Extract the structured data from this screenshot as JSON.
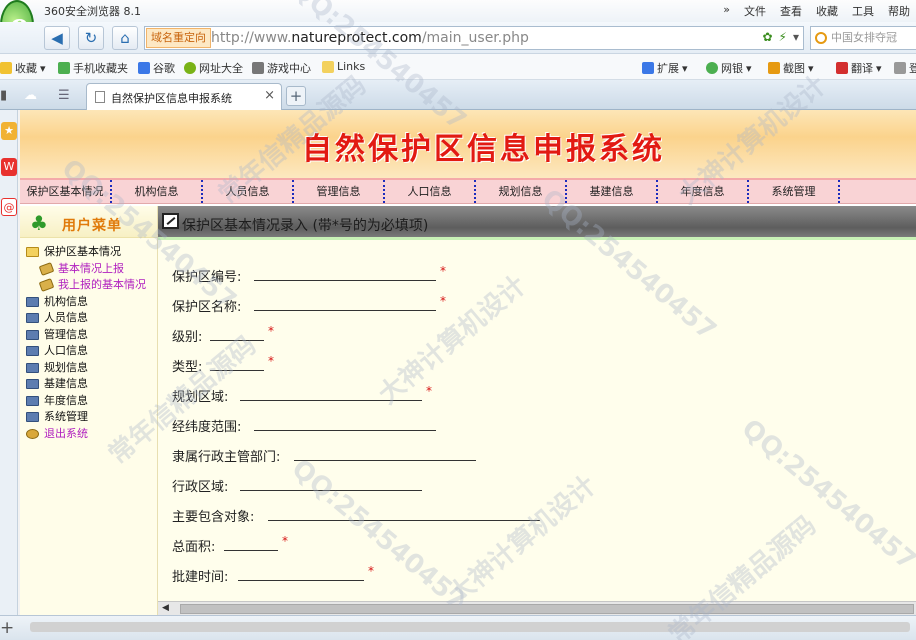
{
  "browser": {
    "title": "360安全浏览器 8.1",
    "menu": [
      "文件",
      "查看",
      "收藏",
      "工具",
      "帮助"
    ]
  },
  "address": {
    "redirect_label": "域名重定向",
    "url_prefix": "http://www.",
    "url_domain": "natureprotect.com",
    "url_path": "/main_user.php",
    "search_placeholder": "中国女排夺冠"
  },
  "bookmarks": {
    "left": [
      "收藏",
      "手机收藏夹",
      "谷歌",
      "网址大全",
      "游戏中心",
      "Links"
    ],
    "right": [
      "扩展",
      "网银",
      "截图",
      "翻译",
      "登"
    ]
  },
  "tab": {
    "title": "自然保护区信息申报系统"
  },
  "page": {
    "banner_title": "自然保护区信息申报系统",
    "nav": [
      "保护区基本情况",
      "机构信息",
      "人员信息",
      "管理信息",
      "人口信息",
      "规划信息",
      "基建信息",
      "年度信息",
      "系统管理"
    ],
    "user_menu_title": "用户菜单",
    "tree": {
      "basic": "保护区基本情况",
      "report": "基本情况上报",
      "my_reports": "我上报的基本情况",
      "org": "机构信息",
      "staff": "人员信息",
      "management": "管理信息",
      "population": "人口信息",
      "planning": "规划信息",
      "construction": "基建信息",
      "annual": "年度信息",
      "system": "系统管理",
      "logout": "退出系统"
    },
    "section_title": "保护区基本情况录入 (带*号的为必填项)",
    "required_mark": "*",
    "form": {
      "code": "保护区编号:",
      "name": "保护区名称:",
      "level": "级别:",
      "type": "类型:",
      "planning_area": "规划区域:",
      "lat_long": "经纬度范围:",
      "department": "隶属行政主管部门:",
      "admin_area": "行政区域:",
      "main_objects": "主要包含对象:",
      "total_area": "总面积:",
      "approval_time": "批建时间:"
    }
  },
  "watermark": {
    "qq": "QQ:254540457",
    "design": "大神计算机设计",
    "long_term": "常年信精品源码"
  }
}
